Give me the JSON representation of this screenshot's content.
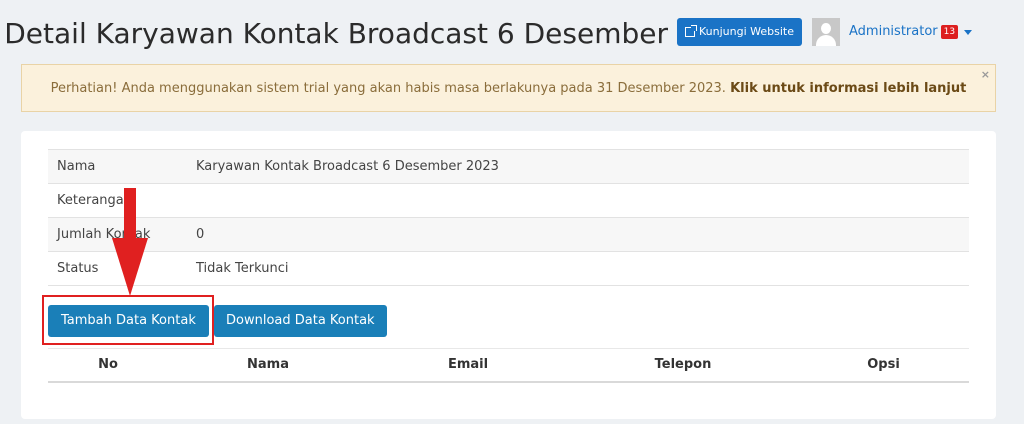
{
  "header": {
    "page_title": "Detail Karyawan Kontak Broadcast 6 Desember",
    "visit_button": "Kunjungi Website",
    "user_name": "Administrator",
    "notification_count": "13"
  },
  "alert": {
    "message": "Perhatian! Anda menggunakan sistem trial yang akan habis masa berlakunya pada 31 Desember 2023.",
    "link": "Klik untuk informasi lebih lanjut",
    "close": "×"
  },
  "details": [
    {
      "label": "Nama",
      "value": "Karyawan Kontak Broadcast 6 Desember 2023"
    },
    {
      "label": "Keterangan",
      "value": ""
    },
    {
      "label": "Jumlah Kontak",
      "value": "0"
    },
    {
      "label": "Status",
      "value": "Tidak Terkunci"
    }
  ],
  "actions": {
    "add": "Tambah Data Kontak",
    "download": "Download Data Kontak"
  },
  "contacts_table": {
    "headers": [
      "No",
      "Nama",
      "Email",
      "Telepon",
      "Opsi"
    ]
  },
  "colors": {
    "primary": "#1a7fb8",
    "annotation": "#e02020",
    "alert_bg": "#fbf1dc",
    "badge": "#dd1f1f"
  }
}
